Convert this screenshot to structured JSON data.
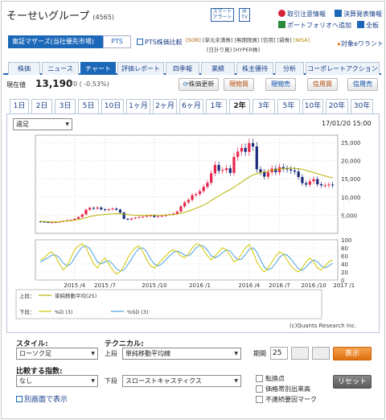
{
  "header": {
    "company": "そーせいグループ",
    "code": "(4565)",
    "smart_alert": "スマート\nアラート",
    "ir_tv": "IR\nTV",
    "links": [
      "取引注意情報",
      "決算発表情報",
      "ポートフォリオへ追加",
      "全板"
    ],
    "exchange": "東証マザーズ(当社優先市場)",
    "pts_btn": "PTS",
    "pts_link": "PTS株価比較",
    "tags": [
      "[SOR]",
      "[単元未満株]",
      "[無期限買]",
      "[信用]",
      "[貸株]",
      "[NISA]",
      "[日計り買]",
      "[HYPER株]"
    ],
    "kabu_link": "対象eワラント"
  },
  "tabs": [
    "株価",
    "ニュース",
    "チャート",
    "評価レポート",
    "四季報",
    "業績",
    "株主優待",
    "分析",
    "コーポレートアクション"
  ],
  "active_tab": "チャート",
  "price": {
    "label": "現在値",
    "value": "13,190",
    "change": "-70 ( -0.53%)",
    "refresh": "株価更新",
    "buy": "現物買",
    "sell": "現物売",
    "margin_buy": "信用買",
    "margin_sell": "信用売"
  },
  "periods": [
    "1日",
    "2日",
    "3日",
    "5日",
    "10日",
    "1ヶ月",
    "2ヶ月",
    "6ヶ月",
    "1年",
    "2年",
    "3年",
    "5年",
    "10年",
    "20年",
    "30年"
  ],
  "active_period": "2年",
  "chart_controls": {
    "interval": "週足",
    "timestamp": "17/01/20 15:00",
    "copyright": "(c)Quants Research Inc."
  },
  "chart_data": {
    "type": "line",
    "main": {
      "price_ticks": [
        "25,000",
        "20,000",
        "15,000",
        "10,000",
        "5,000"
      ],
      "ylim": [
        0,
        27000
      ],
      "closes": [
        3200,
        3100,
        3000,
        3050,
        3100,
        3200,
        3400,
        3600,
        3700,
        4000,
        4500,
        5200,
        6500,
        7000,
        6800,
        7100,
        6600,
        6400,
        6600,
        6800,
        6500,
        5700,
        4000,
        3800,
        4100,
        4300,
        4500,
        4600,
        4800,
        4900,
        4500,
        4700,
        4800,
        5000,
        5200,
        5400,
        6000,
        7400,
        8500,
        9200,
        10500,
        10800,
        11600,
        12800,
        13900,
        16500,
        18800,
        17200,
        17400,
        17900,
        16600,
        21000,
        22500,
        23500,
        22400,
        24800,
        23900,
        17600,
        16800,
        15600,
        16800,
        17800,
        16800,
        18200,
        17800,
        17600,
        17300,
        17000,
        15500,
        13800,
        13400,
        14300,
        14900,
        13500,
        13200,
        13200,
        13400,
        13190
      ],
      "ma25": [
        3300,
        3250,
        3200,
        3150,
        3150,
        3200,
        3300,
        3400,
        3500,
        3600,
        3800,
        4000,
        4300,
        4600,
        4800,
        5000,
        5100,
        5200,
        5300,
        5350,
        5400,
        5350,
        5250,
        5150,
        5050,
        5000,
        4950,
        4950,
        4950,
        5000,
        5000,
        5000,
        5000,
        5050,
        5100,
        5150,
        5300,
        5500,
        5800,
        6100,
        6500,
        6900,
        7300,
        7800,
        8300,
        9000,
        9700,
        10300,
        10900,
        11500,
        12000,
        12700,
        13400,
        14100,
        14800,
        15500,
        16000,
        16400,
        16700,
        16900,
        17100,
        17300,
        17500,
        17700,
        17800,
        17900,
        17900,
        17900,
        17800,
        17600,
        17300,
        17000,
        16700,
        16400,
        16100,
        15800,
        15500,
        15300
      ]
    },
    "sub": {
      "ticks": [
        "100",
        "80",
        "60",
        "40",
        "20",
        "0"
      ],
      "ylim": [
        0,
        100
      ],
      "pctD": [
        50,
        55,
        65,
        70,
        58,
        40,
        25,
        35,
        55,
        75,
        85,
        90,
        80,
        60,
        40,
        30,
        45,
        55,
        40,
        25,
        15,
        20,
        35,
        55,
        70,
        80,
        85,
        70,
        50,
        35,
        30,
        40,
        50,
        60,
        70,
        75,
        70,
        60,
        55,
        65,
        80,
        90,
        88,
        75,
        60,
        50,
        60,
        70,
        80,
        75,
        60,
        45,
        50,
        65,
        80,
        88,
        70,
        45,
        30,
        20,
        30,
        45,
        60,
        70,
        65,
        50,
        35,
        25,
        20,
        30,
        45,
        55,
        45,
        30,
        25,
        35,
        45,
        50
      ],
      "pctSD": [
        45,
        50,
        55,
        62,
        62,
        55,
        42,
        35,
        40,
        55,
        70,
        82,
        85,
        78,
        62,
        45,
        40,
        45,
        48,
        40,
        28,
        22,
        25,
        38,
        52,
        68,
        78,
        80,
        70,
        52,
        40,
        35,
        40,
        50,
        60,
        68,
        72,
        68,
        62,
        60,
        68,
        80,
        86,
        84,
        74,
        60,
        55,
        60,
        68,
        75,
        72,
        60,
        50,
        52,
        63,
        76,
        80,
        70,
        50,
        32,
        25,
        30,
        42,
        56,
        64,
        62,
        52,
        40,
        28,
        24,
        32,
        43,
        50,
        45,
        35,
        30,
        35,
        42
      ],
      "series_names": [
        "%D (3)",
        "%SD (3)"
      ]
    },
    "x_labels": [
      "2015 /4",
      "2015 /7",
      "2015 /10",
      "2016 /1",
      "2016 /4",
      "2016 /7",
      "2016 /10",
      "2017 /1"
    ],
    "upper_legend": [
      {
        "label": "上段：",
        "name": ""
      },
      {
        "label": "",
        "name": "単純移動平均(25)"
      }
    ],
    "lower_legend": [
      {
        "label": "下段：",
        "name": "%D (3)"
      },
      {
        "label": "",
        "name": "%SD (3)"
      }
    ],
    "colors": {
      "up": "#e8254a",
      "down": "#1a2a7a",
      "ma": "#b7b300",
      "pctD": "#d2c800",
      "pctSD": "#4aa0e0"
    }
  },
  "form": {
    "style_label": "スタイル:",
    "style_value": "ローソク足",
    "technical_label": "テクニカル:",
    "upper_label": "上段",
    "upper_value": "単純移動平均線",
    "period_label": "期間",
    "period_value": "25",
    "show_btn": "表示",
    "compare_label": "比較する指数:",
    "compare_value": "なし",
    "lower_label": "下段",
    "lower_value": "スローストキャスティクス",
    "checks": [
      "転換点",
      "価格帯別出来高",
      "不連続要因マーク"
    ],
    "reset_btn": "リセット",
    "separate_link": "別画面で表示"
  }
}
